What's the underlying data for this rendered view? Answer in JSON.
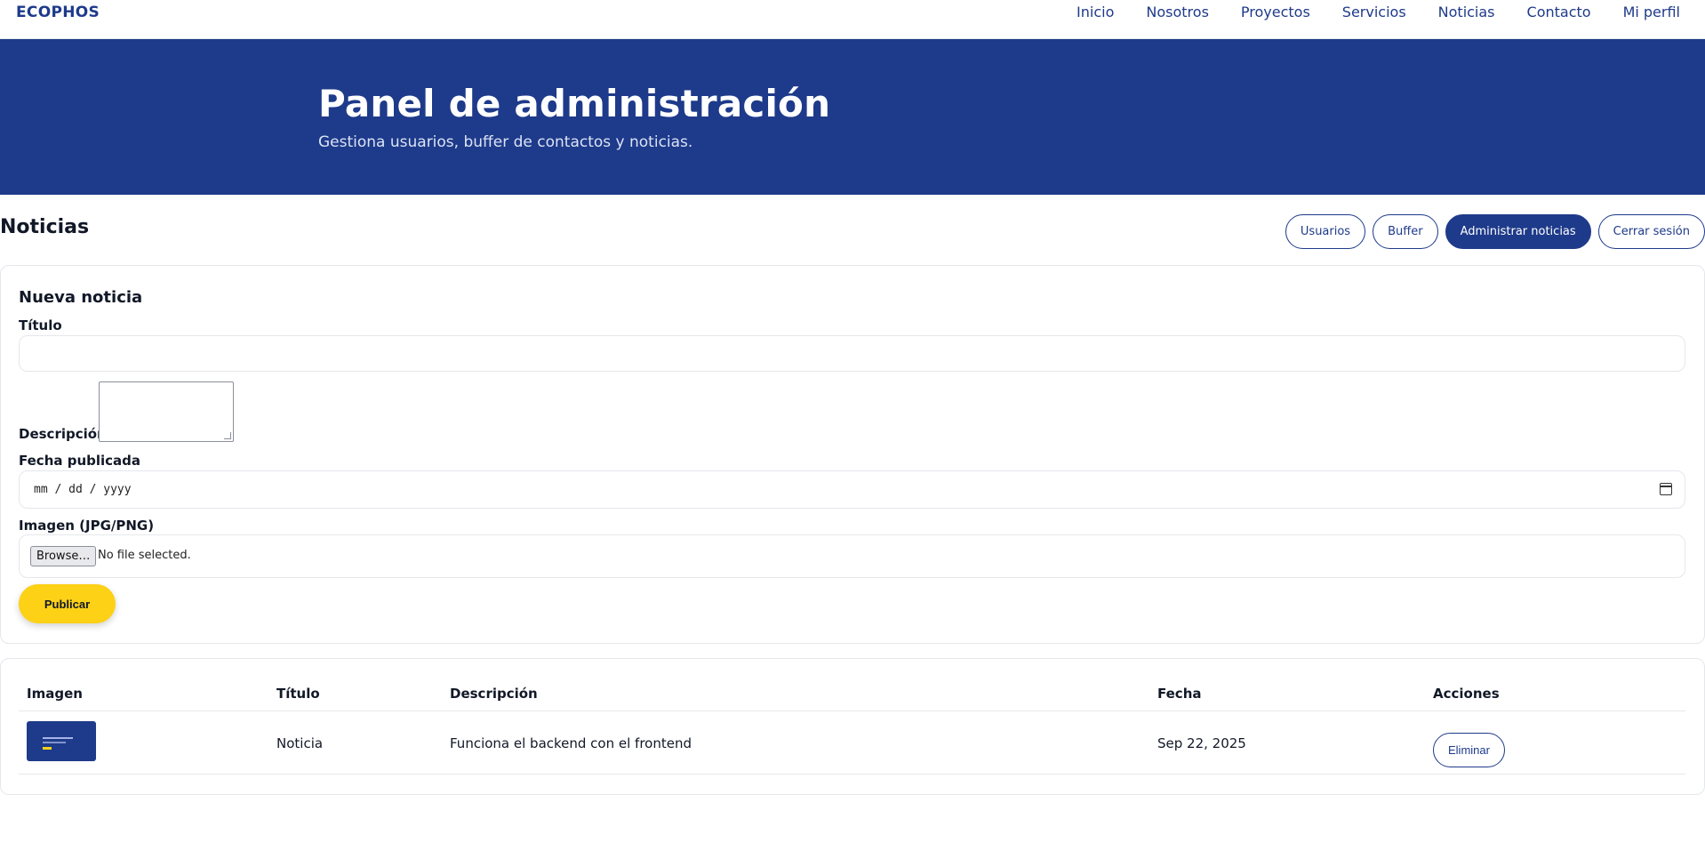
{
  "nav": {
    "brand": "ECOPHOS",
    "links": [
      "Inicio",
      "Nosotros",
      "Proyectos",
      "Servicios",
      "Noticias",
      "Contacto",
      "Mi perfil"
    ]
  },
  "hero": {
    "title": "Panel de administración",
    "subtitle": "Gestiona usuarios, buffer de contactos y noticias."
  },
  "section": {
    "title": "Noticias",
    "tabs": [
      "Usuarios",
      "Buffer",
      "Administrar noticias",
      "Cerrar sesión"
    ],
    "active_tab": "Administrar noticias"
  },
  "form": {
    "heading": "Nueva noticia",
    "title_label": "Título",
    "title_value": "",
    "description_label": "Descripción",
    "date_label": "Fecha publicada",
    "date_placeholder": "mm / dd / yyyy",
    "image_label": "Imagen (JPG/PNG)",
    "browse_label": "Browse…",
    "file_status": "No file selected.",
    "submit_label": "Publicar"
  },
  "table": {
    "headers": [
      "Imagen",
      "Título",
      "Descripción",
      "Fecha",
      "Acciones"
    ],
    "rows": [
      {
        "title": "Noticia",
        "description": "Funciona el backend con el frontend",
        "date": "Sep 22, 2025",
        "action": "Eliminar"
      }
    ]
  },
  "colors": {
    "primary": "#1e3a8a",
    "accent": "#fcd116"
  }
}
